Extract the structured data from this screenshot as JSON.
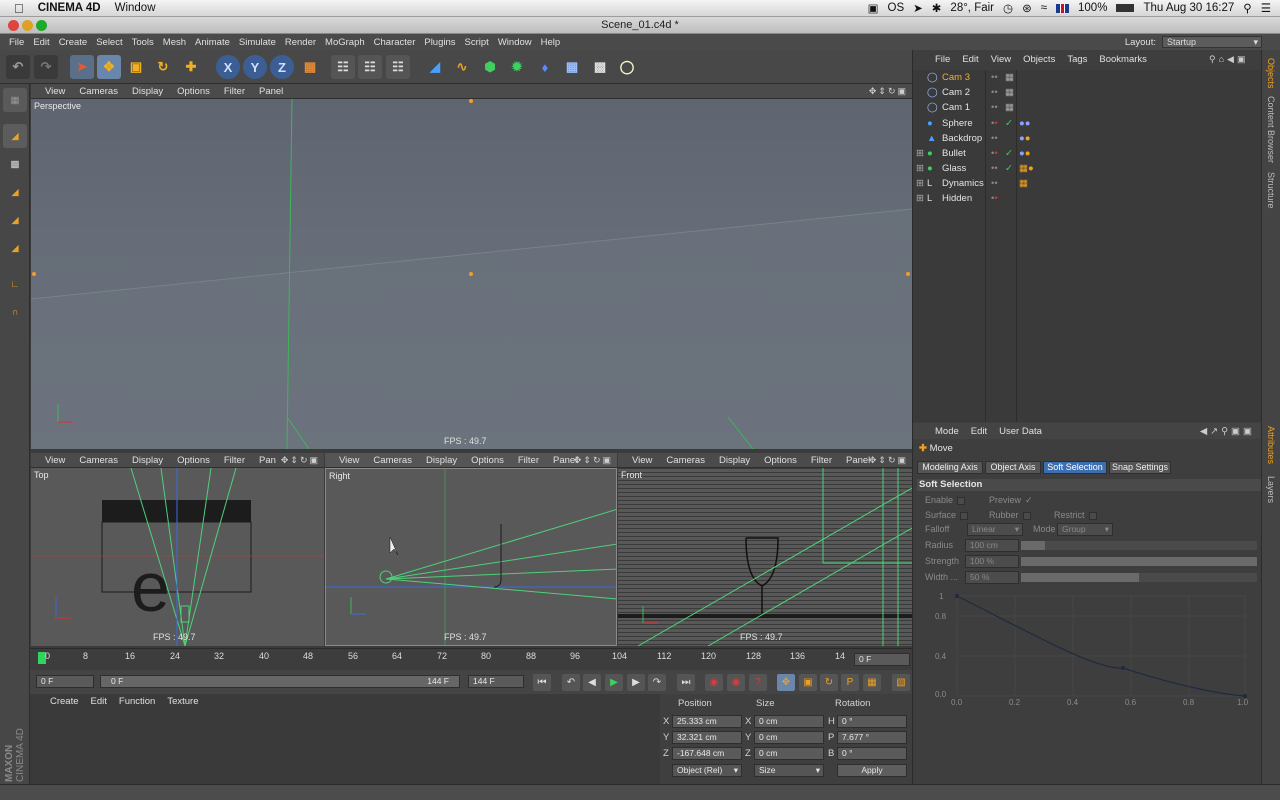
{
  "macos": {
    "app_name": "CINEMA 4D",
    "menu": [
      "Window"
    ],
    "status": {
      "weather": "28°, Fair",
      "battery": "100%",
      "datetime": "Thu Aug 30  16:27",
      "os": "OS"
    }
  },
  "window": {
    "title": "Scene_01.c4d *"
  },
  "menu": {
    "items": [
      "File",
      "Edit",
      "Create",
      "Select",
      "Tools",
      "Mesh",
      "Animate",
      "Simulate",
      "Render",
      "MoGraph",
      "Character",
      "Plugins",
      "Script",
      "Window",
      "Help"
    ],
    "layout_label": "Layout:",
    "layout_value": "Startup"
  },
  "viewport_menu": [
    "View",
    "Cameras",
    "Display",
    "Options",
    "Filter",
    "Panel"
  ],
  "viewport_menu_short": [
    "View",
    "Cameras",
    "Display",
    "Options",
    "Filter",
    "Pan"
  ],
  "viewports": {
    "perspective": {
      "label": "Perspective",
      "fps": "FPS : 49.7"
    },
    "top": {
      "label": "Top",
      "fps": "FPS : 49.7"
    },
    "right": {
      "label": "Right",
      "fps": "FPS : 49.7"
    },
    "front": {
      "label": "Front",
      "fps": "FPS : 49.7"
    }
  },
  "timeline": {
    "ticks": [
      "0",
      "8",
      "16",
      "24",
      "32",
      "40",
      "48",
      "56",
      "64",
      "72",
      "80",
      "88",
      "96",
      "104",
      "112",
      "120",
      "128",
      "136",
      "14"
    ],
    "current_frame": "0 F",
    "start_field": "0 F",
    "range_start": "0 F",
    "range_end": "144 F",
    "end_field": "144 F"
  },
  "material_manager": {
    "menu": [
      "Create",
      "Edit",
      "Function",
      "Texture"
    ],
    "logo_top": "MAXON",
    "logo_bottom": "CINEMA 4D"
  },
  "coordinates": {
    "headers": [
      "Position",
      "Size",
      "Rotation"
    ],
    "rows": [
      {
        "axis": "X",
        "pos": "25.333 cm",
        "saxis": "X",
        "size": "0 cm",
        "raxis": "H",
        "rot": "0 °"
      },
      {
        "axis": "Y",
        "pos": "32.321 cm",
        "saxis": "Y",
        "size": "0 cm",
        "raxis": "P",
        "rot": "7.677 °"
      },
      {
        "axis": "Z",
        "pos": "-167.648 cm",
        "saxis": "Z",
        "size": "0 cm",
        "raxis": "B",
        "rot": "0 °"
      }
    ],
    "mode": "Object (Rel)",
    "size_mode": "Size",
    "apply": "Apply"
  },
  "object_manager": {
    "menu": [
      "File",
      "Edit",
      "View",
      "Objects",
      "Tags",
      "Bookmarks"
    ],
    "objects": [
      {
        "name": "Cam 3",
        "selected": true
      },
      {
        "name": "Cam 2",
        "selected": false
      },
      {
        "name": "Cam 1",
        "selected": false
      },
      {
        "name": "Sphere",
        "selected": false
      },
      {
        "name": "Backdrop",
        "selected": false
      },
      {
        "name": "Bullet",
        "selected": false
      },
      {
        "name": "Glass",
        "selected": false
      },
      {
        "name": "Dynamics",
        "selected": false
      },
      {
        "name": "Hidden",
        "selected": false
      }
    ],
    "side_tabs": [
      "Objects",
      "Content Browser",
      "Structure"
    ]
  },
  "attributes": {
    "menu": [
      "Mode",
      "Edit",
      "User Data"
    ],
    "tool": "Move",
    "tabs": [
      "Modeling Axis",
      "Object Axis",
      "Soft Selection",
      "Snap Settings"
    ],
    "section": "Soft Selection",
    "enable": "Enable",
    "preview": "Preview",
    "surface": "Surface",
    "rubber": "Rubber",
    "restrict": "Restrict",
    "falloff_label": "Falloff",
    "falloff_value": "Linear",
    "mode_label": "Mode",
    "mode_value": "Group",
    "radius_label": "Radius",
    "radius_value": "100 cm",
    "strength_label": "Strength",
    "strength_value": "100 %",
    "width_label": "Width ...",
    "width_value": "50 %",
    "graph_y": [
      "1",
      "0.8",
      "0.4",
      "0.0"
    ],
    "graph_x": [
      "0.0",
      "0.2",
      "0.4",
      "0.6",
      "0.8",
      "1.0"
    ],
    "side_tabs": [
      "Attributes",
      "Layers"
    ]
  }
}
